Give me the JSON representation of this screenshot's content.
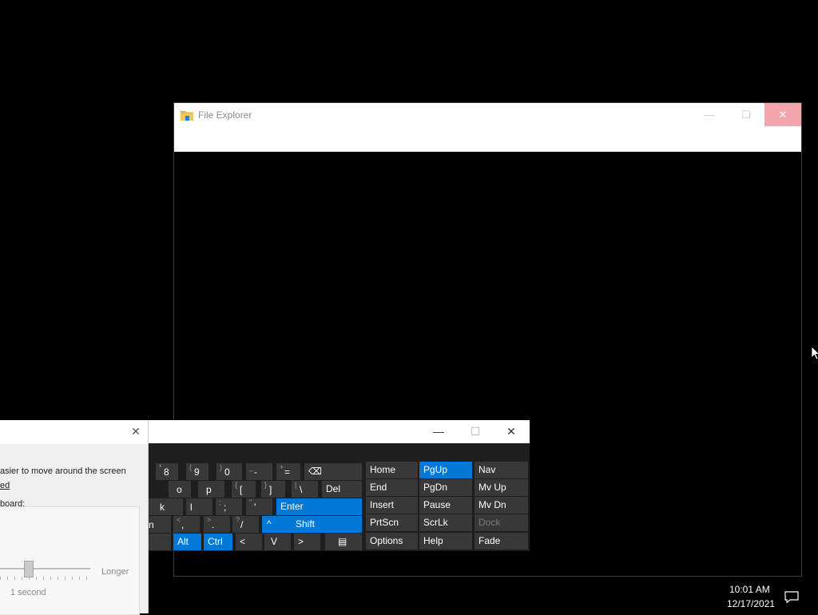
{
  "explorer": {
    "title": "File Explorer",
    "controls": {
      "minimize": "—",
      "maximize": "☐",
      "close": "✕"
    }
  },
  "mouse_settings": {
    "line1": "asier to move around the screen",
    "line2": "ed",
    "line3": "board:",
    "slider_max_label": "Longer",
    "slider_value": "1 second"
  },
  "osk": {
    "controls": {
      "minimize": "—",
      "maximize": "☐",
      "close": "✕"
    },
    "keys": {
      "r1": [
        {
          "top": "*",
          "main": "8"
        },
        {
          "top": "(",
          "main": "9"
        },
        {
          "top": ")",
          "main": "0"
        },
        {
          "top": "_",
          "main": "-"
        },
        {
          "top": "+",
          "main": "="
        },
        {
          "main": "⌫"
        }
      ],
      "r2": [
        {
          "main": "o"
        },
        {
          "main": "p"
        },
        {
          "top": "{",
          "main": "["
        },
        {
          "top": "}",
          "main": "]"
        },
        {
          "top": "|",
          "main": "\\"
        },
        {
          "main": "Del"
        }
      ],
      "r3": [
        {
          "main": "k"
        },
        {
          "main": "l"
        },
        {
          "top": ":",
          "main": ";"
        },
        {
          "top": "\"",
          "main": "'"
        },
        {
          "main": "Enter"
        }
      ],
      "r4": [
        {
          "main": "n"
        },
        {
          "top": "<",
          "main": ","
        },
        {
          "top": ">",
          "main": "."
        },
        {
          "top": "?",
          "main": "/"
        },
        {
          "main": "^"
        },
        {
          "main": "Shift"
        }
      ],
      "r5": [
        {
          "main": "Alt"
        },
        {
          "main": "Ctrl"
        },
        {
          "main": "<"
        },
        {
          "main": "V"
        },
        {
          "main": ">"
        },
        {
          "main": "▤"
        }
      ]
    },
    "nav_keys": {
      "col1": [
        "Home",
        "End",
        "Insert",
        "PrtScn",
        "Options"
      ],
      "col2": [
        "PgUp",
        "PgDn",
        "Pause",
        "ScrLk",
        "Help"
      ],
      "col3": [
        "Nav",
        "Mv Up",
        "Mv Dn",
        "Dock",
        "Fade"
      ]
    },
    "active_color": "#0078d7"
  },
  "taskbar": {
    "time": "10:01 AM",
    "date": "12/17/2021"
  }
}
